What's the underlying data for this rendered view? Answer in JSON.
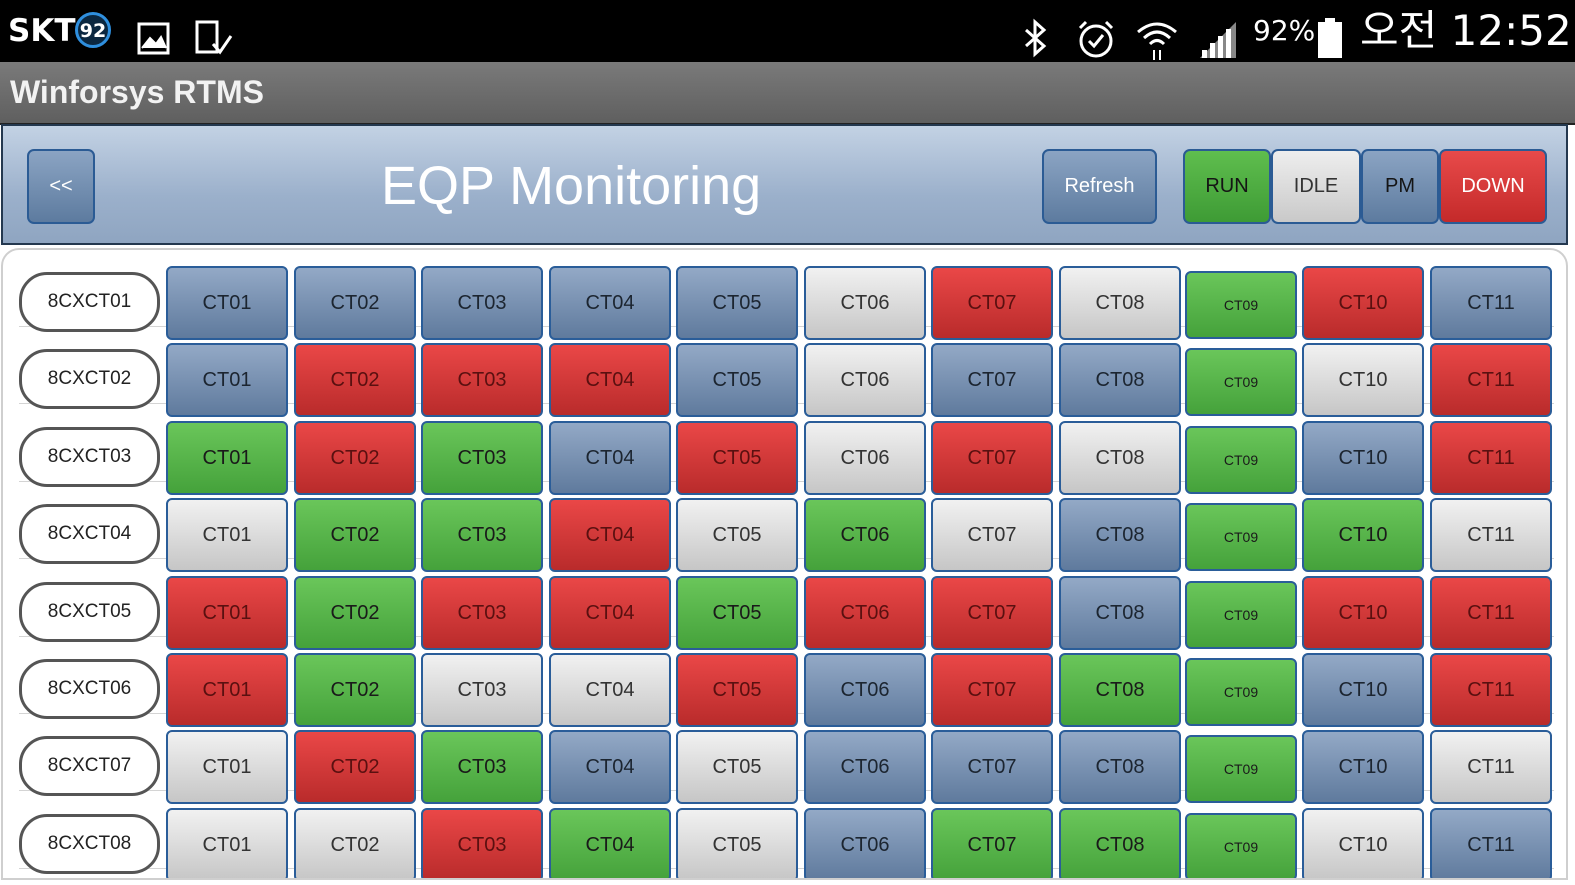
{
  "status_bar": {
    "carrier": "SKT",
    "badge": "92",
    "battery_percent": "92%",
    "time": "오전 12:52",
    "icons": [
      "gallery-icon",
      "download-icon",
      "bluetooth-icon",
      "alarm-icon",
      "wifi-icon",
      "signal-icon",
      "battery-icon"
    ]
  },
  "app": {
    "title": "Winforsys RTMS"
  },
  "header": {
    "back_label": "<<",
    "page_title": "EQP Monitoring",
    "refresh_label": "Refresh",
    "legend": {
      "run": "RUN",
      "idle": "IDLE",
      "pm": "PM",
      "down": "DOWN"
    }
  },
  "colors": {
    "RUN": "#4fae42",
    "IDLE": "#d9d9d9",
    "PM": "#7590b3",
    "DOWN": "#d63939"
  },
  "rows": [
    {
      "eqp": "8CXCT01",
      "cells": [
        {
          "label": "CT01",
          "status": "PM"
        },
        {
          "label": "CT02",
          "status": "PM"
        },
        {
          "label": "CT03",
          "status": "PM"
        },
        {
          "label": "CT04",
          "status": "PM"
        },
        {
          "label": "CT05",
          "status": "PM"
        },
        {
          "label": "CT06",
          "status": "IDLE"
        },
        {
          "label": "CT07",
          "status": "DOWN"
        },
        {
          "label": "CT08",
          "status": "IDLE"
        },
        {
          "label": "CT09",
          "status": "RUN"
        },
        {
          "label": "CT10",
          "status": "DOWN"
        },
        {
          "label": "CT11",
          "status": "PM"
        }
      ]
    },
    {
      "eqp": "8CXCT02",
      "cells": [
        {
          "label": "CT01",
          "status": "PM"
        },
        {
          "label": "CT02",
          "status": "DOWN"
        },
        {
          "label": "CT03",
          "status": "DOWN"
        },
        {
          "label": "CT04",
          "status": "DOWN"
        },
        {
          "label": "CT05",
          "status": "PM"
        },
        {
          "label": "CT06",
          "status": "IDLE"
        },
        {
          "label": "CT07",
          "status": "PM"
        },
        {
          "label": "CT08",
          "status": "PM"
        },
        {
          "label": "CT09",
          "status": "RUN"
        },
        {
          "label": "CT10",
          "status": "IDLE"
        },
        {
          "label": "CT11",
          "status": "DOWN"
        }
      ]
    },
    {
      "eqp": "8CXCT03",
      "cells": [
        {
          "label": "CT01",
          "status": "RUN"
        },
        {
          "label": "CT02",
          "status": "DOWN"
        },
        {
          "label": "CT03",
          "status": "RUN"
        },
        {
          "label": "CT04",
          "status": "PM"
        },
        {
          "label": "CT05",
          "status": "DOWN"
        },
        {
          "label": "CT06",
          "status": "IDLE"
        },
        {
          "label": "CT07",
          "status": "DOWN"
        },
        {
          "label": "CT08",
          "status": "IDLE"
        },
        {
          "label": "CT09",
          "status": "RUN"
        },
        {
          "label": "CT10",
          "status": "PM"
        },
        {
          "label": "CT11",
          "status": "DOWN"
        }
      ]
    },
    {
      "eqp": "8CXCT04",
      "cells": [
        {
          "label": "CT01",
          "status": "IDLE"
        },
        {
          "label": "CT02",
          "status": "RUN"
        },
        {
          "label": "CT03",
          "status": "RUN"
        },
        {
          "label": "CT04",
          "status": "DOWN"
        },
        {
          "label": "CT05",
          "status": "IDLE"
        },
        {
          "label": "CT06",
          "status": "RUN"
        },
        {
          "label": "CT07",
          "status": "IDLE"
        },
        {
          "label": "CT08",
          "status": "PM"
        },
        {
          "label": "CT09",
          "status": "RUN"
        },
        {
          "label": "CT10",
          "status": "RUN"
        },
        {
          "label": "CT11",
          "status": "IDLE"
        }
      ]
    },
    {
      "eqp": "8CXCT05",
      "cells": [
        {
          "label": "CT01",
          "status": "DOWN"
        },
        {
          "label": "CT02",
          "status": "RUN"
        },
        {
          "label": "CT03",
          "status": "DOWN"
        },
        {
          "label": "CT04",
          "status": "DOWN"
        },
        {
          "label": "CT05",
          "status": "RUN"
        },
        {
          "label": "CT06",
          "status": "DOWN"
        },
        {
          "label": "CT07",
          "status": "DOWN"
        },
        {
          "label": "CT08",
          "status": "PM"
        },
        {
          "label": "CT09",
          "status": "RUN"
        },
        {
          "label": "CT10",
          "status": "DOWN"
        },
        {
          "label": "CT11",
          "status": "DOWN"
        }
      ]
    },
    {
      "eqp": "8CXCT06",
      "cells": [
        {
          "label": "CT01",
          "status": "DOWN"
        },
        {
          "label": "CT02",
          "status": "RUN"
        },
        {
          "label": "CT03",
          "status": "IDLE"
        },
        {
          "label": "CT04",
          "status": "IDLE"
        },
        {
          "label": "CT05",
          "status": "DOWN"
        },
        {
          "label": "CT06",
          "status": "PM"
        },
        {
          "label": "CT07",
          "status": "DOWN"
        },
        {
          "label": "CT08",
          "status": "RUN"
        },
        {
          "label": "CT09",
          "status": "RUN"
        },
        {
          "label": "CT10",
          "status": "PM"
        },
        {
          "label": "CT11",
          "status": "DOWN"
        }
      ]
    },
    {
      "eqp": "8CXCT07",
      "cells": [
        {
          "label": "CT01",
          "status": "IDLE"
        },
        {
          "label": "CT02",
          "status": "DOWN"
        },
        {
          "label": "CT03",
          "status": "RUN"
        },
        {
          "label": "CT04",
          "status": "PM"
        },
        {
          "label": "CT05",
          "status": "IDLE"
        },
        {
          "label": "CT06",
          "status": "PM"
        },
        {
          "label": "CT07",
          "status": "PM"
        },
        {
          "label": "CT08",
          "status": "PM"
        },
        {
          "label": "CT09",
          "status": "RUN"
        },
        {
          "label": "CT10",
          "status": "PM"
        },
        {
          "label": "CT11",
          "status": "IDLE"
        }
      ]
    },
    {
      "eqp": "8CXCT08",
      "cells": [
        {
          "label": "CT01",
          "status": "IDLE"
        },
        {
          "label": "CT02",
          "status": "IDLE"
        },
        {
          "label": "CT03",
          "status": "DOWN"
        },
        {
          "label": "CT04",
          "status": "RUN"
        },
        {
          "label": "CT05",
          "status": "IDLE"
        },
        {
          "label": "CT06",
          "status": "PM"
        },
        {
          "label": "CT07",
          "status": "RUN"
        },
        {
          "label": "CT08",
          "status": "RUN"
        },
        {
          "label": "CT09",
          "status": "RUN"
        },
        {
          "label": "CT10",
          "status": "IDLE"
        },
        {
          "label": "CT11",
          "status": "PM"
        }
      ]
    }
  ]
}
